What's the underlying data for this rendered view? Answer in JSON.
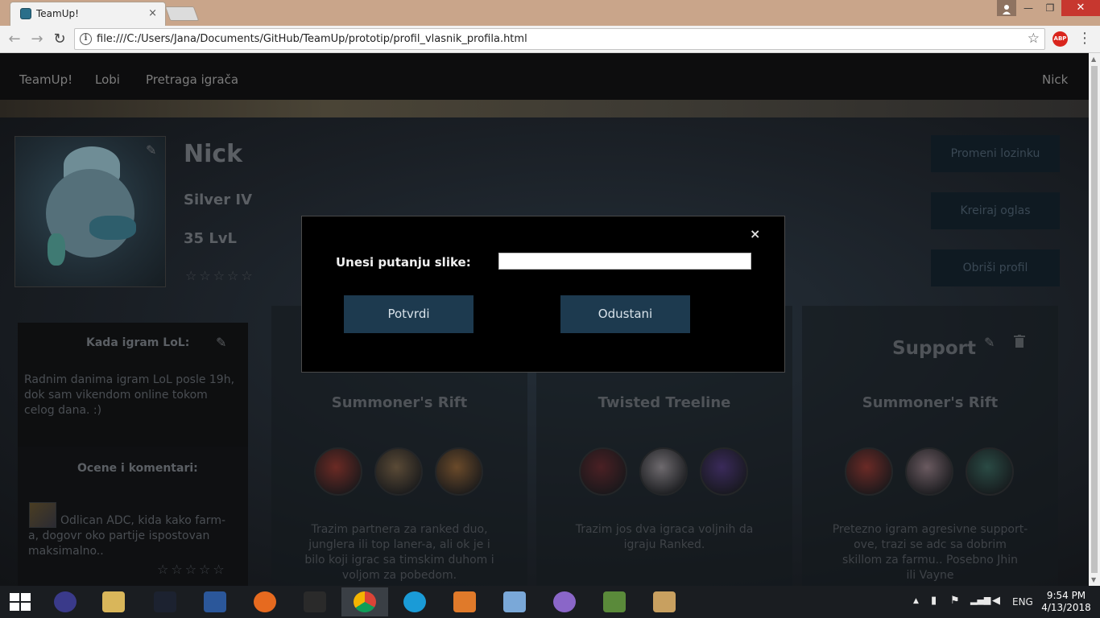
{
  "browser": {
    "tab_title": "TeamUp!",
    "tab_close": "×",
    "window_minimize": "—",
    "window_maximize": "❐",
    "window_close": "✕",
    "url": "file:///C:/Users/Jana/Documents/GitHub/TeamUp/prototip/profil_vlasnik_profila.html",
    "back_icon": "←",
    "forward_icon": "→",
    "reload_icon": "↻",
    "info_icon": "i",
    "bookmark_star": "☆",
    "adblock_label": "ABP",
    "menu_icon": "⋮"
  },
  "nav": {
    "brand": "TeamUp!",
    "lobby": "Lobi",
    "search": "Pretraga igrača",
    "user": "Nick"
  },
  "profile": {
    "name": "Nick",
    "rank": "Silver IV",
    "level": "35 LvL",
    "rating_stars": "☆☆☆☆☆",
    "change_password": "Promeni lozinku",
    "create_ad": "Kreiraj oglas",
    "delete_profile": "Obriši profil"
  },
  "when_i_play": {
    "heading": "Kada igram LoL:",
    "text_lines": [
      "Radnim danima igram LoL posle 19h,",
      "dok sam vikendom online tokom",
      "celog dana. :)"
    ]
  },
  "ratings": {
    "heading": "Ocene i komentari:",
    "comment_lines": [
      "Odlican ADC, kida kako farm-",
      "a, dogovr oko partije ispostovan",
      "maksimalno.."
    ],
    "comment_stars": "☆☆☆☆☆"
  },
  "ads": [
    {
      "map": "Summoner's Rift",
      "desc_lines": [
        "Trazim partnera za ranked duo,",
        "junglera ili top laner-a, ali ok je i",
        "bilo koji igrac sa timskim duhom i",
        "voljom za pobedom."
      ],
      "champion_colors": [
        "#6b2a24",
        "#5a4a36",
        "#6a4a2a"
      ]
    },
    {
      "map": "Twisted Treeline",
      "desc_lines": [
        "Trazim jos dva igraca voljnih da",
        "igraju Ranked."
      ],
      "champion_colors": [
        "#4a2024",
        "#6e6a6e",
        "#3a2a5a"
      ]
    },
    {
      "role": "Support",
      "map": "Summoner's Rift",
      "desc_lines": [
        "Pretezno igram agresivne support-",
        "ove, trazi se adc sa dobrim",
        "skillom za farmu.. Posebno Jhin",
        "ili Vayne"
      ],
      "champion_colors": [
        "#6a2a26",
        "#6a5a60",
        "#2a4a44"
      ]
    }
  ],
  "modal": {
    "close": "×",
    "label": "Unesi putanju slike:",
    "input_value": "",
    "confirm": "Potvrdi",
    "cancel": "Odustani"
  },
  "taskbar": {
    "language": "ENG",
    "time": "9:54 PM",
    "date": "4/13/2018",
    "app_colors": [
      "#3a3a8a",
      "#d9b65a",
      "#1c2230",
      "#2b579a",
      "#e66a1f",
      "#2a2a2a",
      "#dcdcdc",
      "#1a9bd7",
      "#e07a2a",
      "#7aa8d8",
      "#8a66c8",
      "#5a8a3a",
      "#c8a060"
    ]
  }
}
